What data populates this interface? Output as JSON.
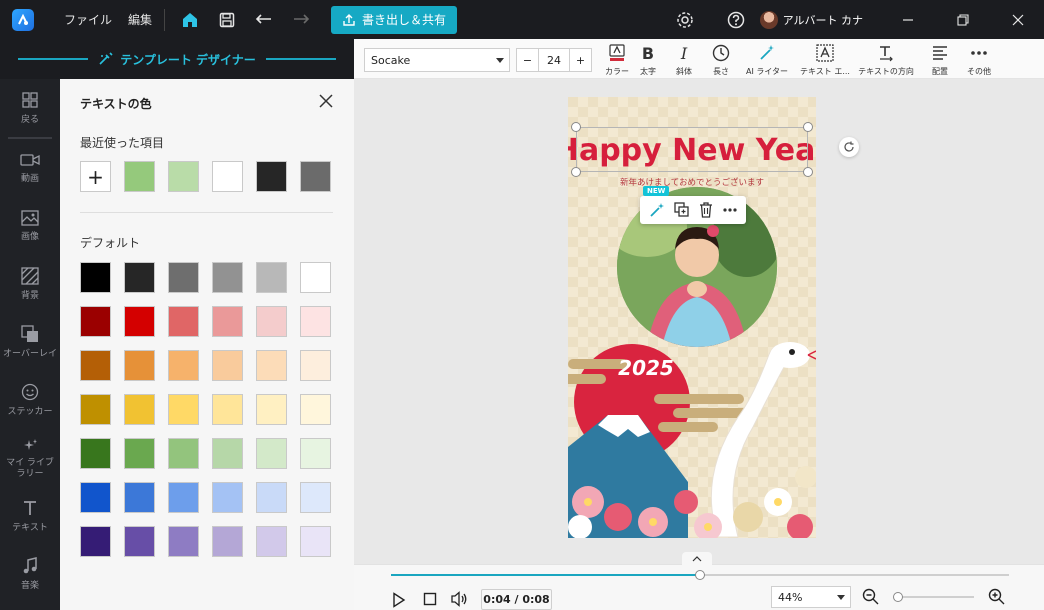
{
  "menu": {
    "file": "ファイル",
    "edit": "編集"
  },
  "export_label": "書き出し＆共有",
  "user": {
    "name": "アルバート カナ"
  },
  "designer_title": "テンプレート デザイナー",
  "sidebar": {
    "items": [
      {
        "label": "戻る",
        "icon": "grid-icon"
      },
      {
        "label": "動画",
        "icon": "video-icon"
      },
      {
        "label": "画像",
        "icon": "image-icon"
      },
      {
        "label": "背景",
        "icon": "background-icon"
      },
      {
        "label": "オーバーレイ",
        "icon": "overlay-icon"
      },
      {
        "label": "ステッカー",
        "icon": "sticker-icon"
      },
      {
        "label": "マイ ライブラリー",
        "icon": "library-icon"
      },
      {
        "label": "テキスト",
        "icon": "text-icon"
      },
      {
        "label": "音楽",
        "icon": "music-icon"
      }
    ]
  },
  "color_panel": {
    "title": "テキストの色",
    "recent_heading": "最近使った項目",
    "default_heading": "デフォルト",
    "add_symbol": "+",
    "recent_colors": [
      "#95c97c",
      "#b9dca8",
      "#ffffff",
      "#262626",
      "#6b6b6b"
    ],
    "default_colors": [
      [
        "#000000",
        "#262626",
        "#6e6e6e",
        "#929292",
        "#b8b8b8",
        "#ffffff"
      ],
      [
        "#9b0000",
        "#d40000",
        "#e06666",
        "#ea9999",
        "#f4cccc",
        "#fde3e3"
      ],
      [
        "#b45f06",
        "#e69138",
        "#f6b26b",
        "#f9cb9c",
        "#fcdcb8",
        "#fdeedd"
      ],
      [
        "#bf9000",
        "#f1c232",
        "#ffd966",
        "#ffe599",
        "#fff0c2",
        "#fff6dc"
      ],
      [
        "#38761d",
        "#6aa84f",
        "#93c47d",
        "#b6d7a8",
        "#d3e9c9",
        "#e7f4e1"
      ],
      [
        "#1155cc",
        "#3c78d8",
        "#6d9eeb",
        "#a4c2f4",
        "#c9daf8",
        "#dde8fb"
      ],
      [
        "#351c75",
        "#674ea7",
        "#8e7cc3",
        "#b4a7d6",
        "#d2c9ea",
        "#e9e4f7"
      ]
    ]
  },
  "toolbar": {
    "font": "Socake",
    "font_size": "24",
    "minus": "−",
    "plus": "+",
    "tools": [
      {
        "label": "カラー",
        "icon": "text-color-icon"
      },
      {
        "label": "太字",
        "icon": "bold-icon"
      },
      {
        "label": "斜体",
        "icon": "italic-icon"
      },
      {
        "label": "長さ",
        "icon": "duration-icon"
      },
      {
        "label": "AI ライター",
        "icon": "ai-writer-icon"
      },
      {
        "label": "テキスト エ...",
        "icon": "text-effect-icon"
      },
      {
        "label": "テキストの方向",
        "icon": "text-direction-icon"
      },
      {
        "label": "配置",
        "icon": "align-icon"
      },
      {
        "label": "その他",
        "icon": "more-icon"
      }
    ]
  },
  "canvas": {
    "headline": "Happy New Year",
    "subtitle": "新年あけましておめでとうございます",
    "year": "2025",
    "new_badge": "NEW"
  },
  "timeline": {
    "time": "0:04 / 0:08",
    "progress": 0.5,
    "zoom": "44%",
    "zoom_level": 0.05
  }
}
